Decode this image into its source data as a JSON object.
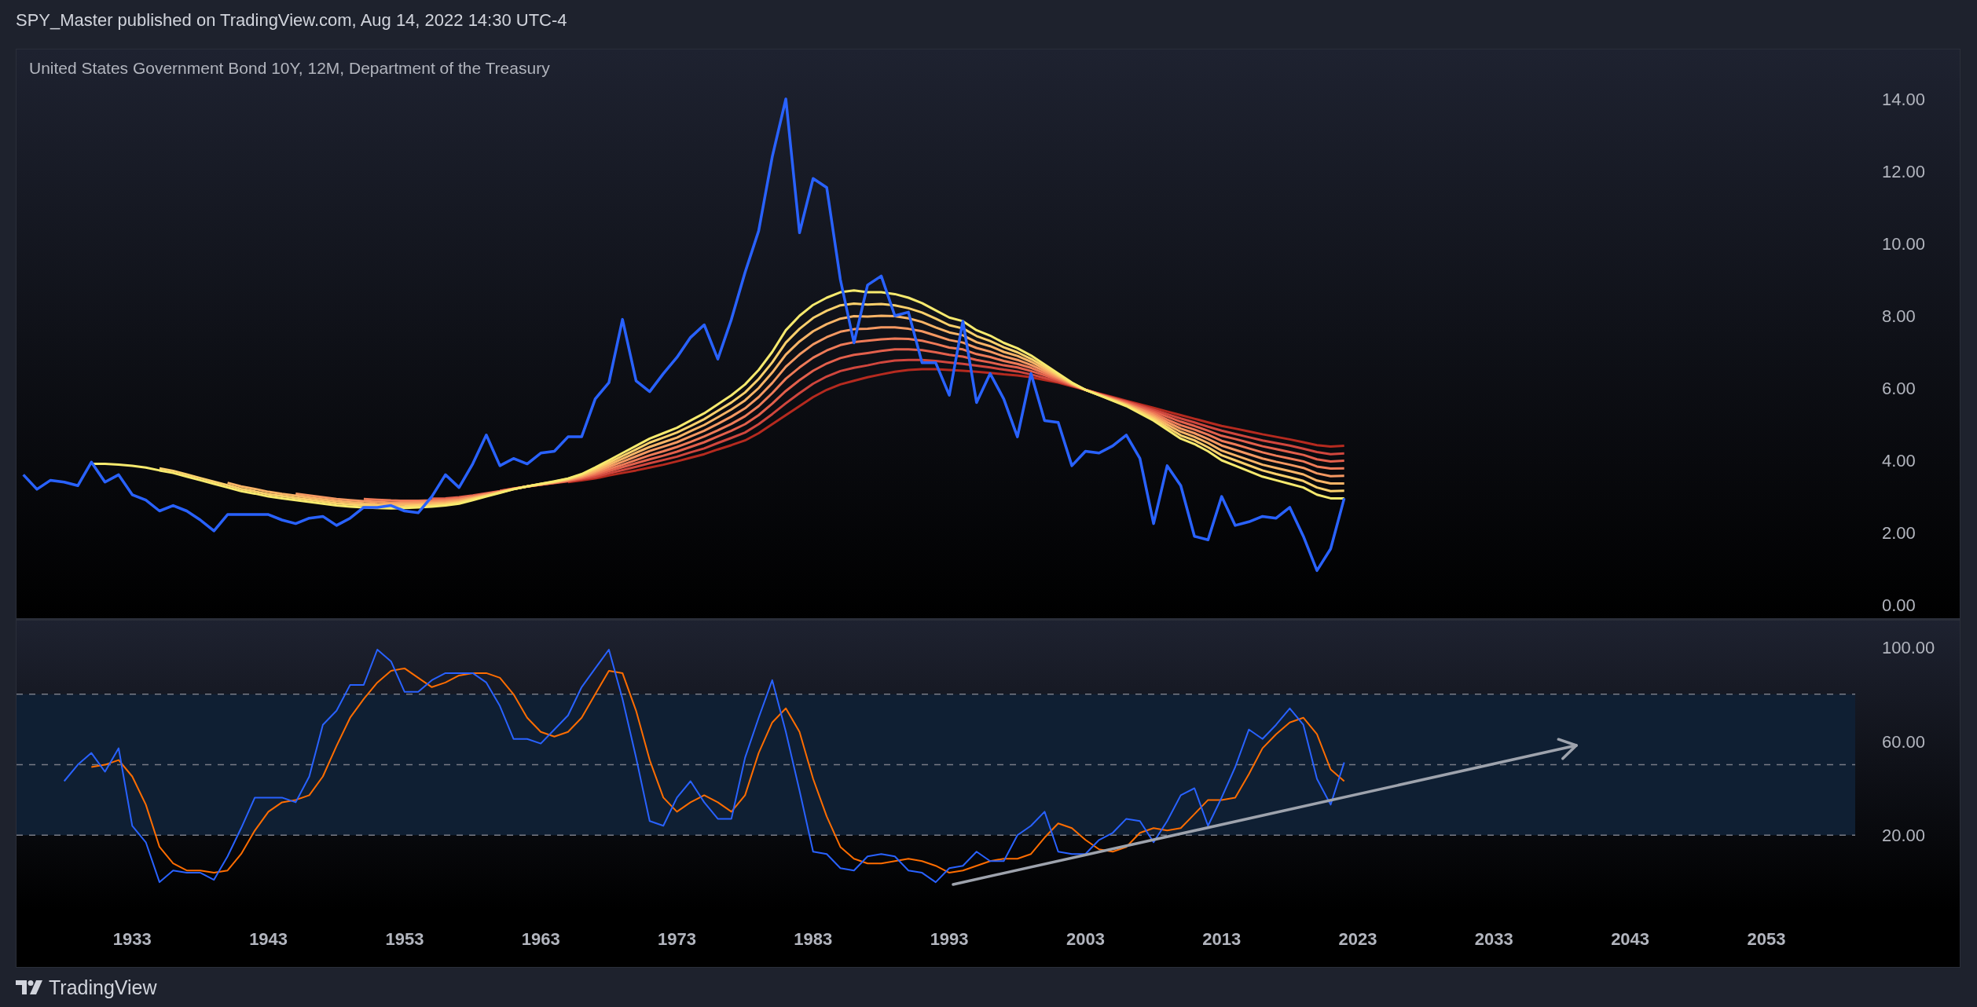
{
  "header": {
    "publish_line": "SPY_Master published on TradingView.com, Aug 14, 2022 14:30 UTC-4"
  },
  "chart": {
    "title": "United States Government Bond 10Y, 12M, Department of the Treasury",
    "price_pane": {
      "chart_data": {
        "type": "line",
        "x": [
          1925,
          1926,
          1927,
          1928,
          1929,
          1930,
          1931,
          1932,
          1933,
          1934,
          1935,
          1936,
          1937,
          1938,
          1939,
          1940,
          1941,
          1942,
          1943,
          1944,
          1945,
          1946,
          1947,
          1948,
          1949,
          1950,
          1951,
          1952,
          1953,
          1954,
          1955,
          1956,
          1957,
          1958,
          1959,
          1960,
          1961,
          1962,
          1963,
          1964,
          1965,
          1966,
          1967,
          1968,
          1969,
          1970,
          1971,
          1972,
          1973,
          1974,
          1975,
          1976,
          1977,
          1978,
          1979,
          1980,
          1981,
          1982,
          1983,
          1984,
          1985,
          1986,
          1987,
          1988,
          1989,
          1990,
          1991,
          1992,
          1993,
          1994,
          1995,
          1996,
          1997,
          1998,
          1999,
          2000,
          2001,
          2002,
          2003,
          2004,
          2005,
          2006,
          2007,
          2008,
          2009,
          2010,
          2011,
          2012,
          2013,
          2014,
          2015,
          2016,
          2017,
          2018,
          2019,
          2020,
          2021,
          2022
        ],
        "series": [
          {
            "color": "#2962ff",
            "values": [
              3.6,
              3.2,
              3.45,
              3.4,
              3.3,
              3.95,
              3.4,
              3.6,
              3.05,
              2.9,
              2.6,
              2.75,
              2.6,
              2.35,
              2.05,
              2.5,
              2.5,
              2.5,
              2.5,
              2.35,
              2.25,
              2.4,
              2.45,
              2.2,
              2.4,
              2.7,
              2.7,
              2.75,
              2.6,
              2.55,
              3.0,
              3.6,
              3.25,
              3.9,
              4.7,
              3.85,
              4.05,
              3.9,
              4.2,
              4.25,
              4.65,
              4.65,
              5.7,
              6.15,
              7.9,
              6.2,
              5.9,
              6.4,
              6.85,
              7.4,
              7.75,
              6.8,
              7.9,
              9.2,
              10.35,
              12.4,
              14.0,
              10.3,
              11.8,
              11.55,
              9.0,
              7.25,
              8.85,
              9.1,
              8.0,
              8.1,
              6.7,
              6.7,
              5.8,
              7.85,
              5.6,
              6.4,
              5.7,
              4.65,
              6.4,
              5.1,
              5.05,
              3.85,
              4.25,
              4.2,
              4.4,
              4.7,
              4.05,
              2.25,
              3.85,
              3.3,
              1.9,
              1.8,
              3.0,
              2.2,
              2.3,
              2.45,
              2.4,
              2.7,
              1.9,
              0.95,
              1.55,
              2.95
            ]
          },
          {
            "color": "#f7ea6e",
            "values": [
              null,
              null,
              null,
              null,
              null,
              3.9,
              3.9,
              3.88,
              3.85,
              3.8,
              3.72,
              3.65,
              3.55,
              3.45,
              3.35,
              3.25,
              3.15,
              3.08,
              3.0,
              2.95,
              2.9,
              2.85,
              2.8,
              2.75,
              2.72,
              2.7,
              2.68,
              2.67,
              2.68,
              2.7,
              2.72,
              2.75,
              2.8,
              2.9,
              3.0,
              3.1,
              3.2,
              3.28,
              3.35,
              3.42,
              3.5,
              3.62,
              3.8,
              4.0,
              4.2,
              4.4,
              4.6,
              4.75,
              4.9,
              5.1,
              5.3,
              5.55,
              5.8,
              6.1,
              6.5,
              7.0,
              7.6,
              8.0,
              8.3,
              8.5,
              8.65,
              8.7,
              8.65,
              8.65,
              8.6,
              8.5,
              8.35,
              8.15,
              7.95,
              7.85,
              7.6,
              7.45,
              7.25,
              7.1,
              6.9,
              6.65,
              6.4,
              6.15,
              5.95,
              5.8,
              5.65,
              5.5,
              5.3,
              5.1,
              4.85,
              4.6,
              4.45,
              4.25,
              4.0,
              3.85,
              3.7,
              3.55,
              3.45,
              3.35,
              3.25,
              3.05,
              2.95,
              2.95
            ]
          },
          {
            "color": "#fbd06c",
            "values": [
              null,
              null,
              null,
              null,
              null,
              null,
              null,
              null,
              null,
              null,
              3.78,
              3.71,
              3.61,
              3.51,
              3.41,
              3.31,
              3.21,
              3.14,
              3.06,
              3.01,
              2.96,
              2.91,
              2.86,
              2.81,
              2.78,
              2.76,
              2.74,
              2.72,
              2.73,
              2.75,
              2.76,
              2.79,
              2.84,
              2.93,
              3.02,
              3.11,
              3.2,
              3.28,
              3.35,
              3.41,
              3.49,
              3.6,
              3.76,
              3.94,
              4.12,
              4.3,
              4.49,
              4.63,
              4.77,
              4.95,
              5.14,
              5.37,
              5.6,
              5.88,
              6.25,
              6.71,
              7.26,
              7.64,
              7.94,
              8.14,
              8.29,
              8.34,
              8.31,
              8.33,
              8.29,
              8.21,
              8.09,
              7.92,
              7.74,
              7.65,
              7.44,
              7.3,
              7.13,
              6.99,
              6.81,
              6.59,
              6.36,
              6.14,
              5.95,
              5.81,
              5.66,
              5.52,
              5.34,
              5.15,
              4.92,
              4.69,
              4.55,
              4.36,
              4.14,
              4.0,
              3.86,
              3.72,
              3.62,
              3.53,
              3.43,
              3.25,
              3.15,
              3.16
            ]
          },
          {
            "color": "#f9b467",
            "values": [
              null,
              null,
              null,
              null,
              null,
              null,
              null,
              null,
              null,
              null,
              null,
              null,
              null,
              null,
              null,
              3.38,
              3.28,
              3.21,
              3.13,
              3.07,
              3.02,
              2.97,
              2.92,
              2.87,
              2.84,
              2.81,
              2.79,
              2.78,
              2.78,
              2.79,
              2.81,
              2.83,
              2.87,
              2.95,
              3.03,
              3.12,
              3.21,
              3.28,
              3.34,
              3.4,
              3.47,
              3.57,
              3.71,
              3.88,
              4.04,
              4.21,
              4.37,
              4.5,
              4.63,
              4.81,
              4.98,
              5.19,
              5.41,
              5.66,
              6.0,
              6.43,
              6.93,
              7.29,
              7.57,
              7.77,
              7.92,
              7.99,
              7.98,
              8.0,
              7.99,
              7.93,
              7.83,
              7.68,
              7.54,
              7.46,
              7.27,
              7.16,
              7.0,
              6.89,
              6.73,
              6.53,
              6.33,
              6.12,
              5.95,
              5.81,
              5.68,
              5.54,
              5.37,
              5.2,
              4.99,
              4.79,
              4.65,
              4.48,
              4.27,
              4.14,
              4.01,
              3.88,
              3.79,
              3.7,
              3.61,
              3.44,
              3.36,
              3.36
            ]
          },
          {
            "color": "#f59862",
            "values": [
              null,
              null,
              null,
              null,
              null,
              null,
              null,
              null,
              null,
              null,
              null,
              null,
              null,
              null,
              null,
              null,
              null,
              null,
              null,
              null,
              3.08,
              3.03,
              2.98,
              2.93,
              2.9,
              2.87,
              2.85,
              2.83,
              2.83,
              2.84,
              2.85,
              2.87,
              2.91,
              2.98,
              3.05,
              3.13,
              3.21,
              3.28,
              3.34,
              3.39,
              3.46,
              3.55,
              3.67,
              3.82,
              3.96,
              4.11,
              4.26,
              4.38,
              4.5,
              4.66,
              4.82,
              5.01,
              5.21,
              5.44,
              5.75,
              6.14,
              6.59,
              6.93,
              7.21,
              7.41,
              7.56,
              7.63,
              7.64,
              7.68,
              7.68,
              7.64,
              7.57,
              7.45,
              7.33,
              7.26,
              7.11,
              7.01,
              6.88,
              6.78,
              6.64,
              6.47,
              6.29,
              6.11,
              5.95,
              5.82,
              5.69,
              5.56,
              5.41,
              5.25,
              5.06,
              4.88,
              4.75,
              4.59,
              4.41,
              4.29,
              4.17,
              4.05,
              3.96,
              3.88,
              3.79,
              3.64,
              3.56,
              3.57
            ]
          },
          {
            "color": "#ef7b58",
            "values": [
              null,
              null,
              null,
              null,
              null,
              null,
              null,
              null,
              null,
              null,
              null,
              null,
              null,
              null,
              null,
              null,
              null,
              null,
              null,
              null,
              null,
              null,
              null,
              null,
              null,
              2.93,
              2.91,
              2.89,
              2.88,
              2.88,
              2.89,
              2.91,
              2.94,
              3.0,
              3.07,
              3.14,
              3.21,
              3.28,
              3.33,
              3.38,
              3.44,
              3.52,
              3.63,
              3.76,
              3.88,
              4.01,
              4.14,
              4.25,
              4.37,
              4.51,
              4.66,
              4.83,
              5.01,
              5.22,
              5.5,
              5.86,
              6.26,
              6.57,
              6.84,
              7.04,
              7.19,
              7.27,
              7.31,
              7.35,
              7.37,
              7.36,
              7.31,
              7.22,
              7.12,
              7.07,
              6.94,
              6.86,
              6.75,
              6.67,
              6.56,
              6.41,
              6.26,
              6.09,
              5.95,
              5.83,
              5.71,
              5.58,
              5.44,
              5.3,
              5.13,
              4.97,
              4.85,
              4.71,
              4.54,
              4.44,
              4.33,
              4.22,
              4.13,
              4.05,
              3.97,
              3.83,
              3.77,
              3.78
            ]
          },
          {
            "color": "#e3604c",
            "values": [
              null,
              null,
              null,
              null,
              null,
              null,
              null,
              null,
              null,
              null,
              null,
              null,
              null,
              null,
              null,
              null,
              null,
              null,
              null,
              null,
              null,
              null,
              null,
              null,
              null,
              null,
              null,
              null,
              null,
              null,
              2.94,
              2.95,
              2.98,
              3.03,
              3.09,
              3.15,
              3.22,
              3.28,
              3.33,
              3.38,
              3.43,
              3.5,
              3.59,
              3.7,
              3.81,
              3.92,
              4.03,
              4.13,
              4.24,
              4.37,
              4.5,
              4.66,
              4.82,
              5.0,
              5.25,
              5.57,
              5.92,
              6.22,
              6.48,
              6.68,
              6.83,
              6.92,
              6.97,
              7.03,
              7.07,
              7.07,
              7.05,
              6.99,
              6.92,
              6.87,
              6.78,
              6.71,
              6.63,
              6.57,
              6.47,
              6.35,
              6.22,
              6.08,
              5.95,
              5.84,
              5.72,
              5.61,
              5.48,
              5.35,
              5.21,
              5.07,
              4.95,
              4.82,
              4.68,
              4.59,
              4.49,
              4.39,
              4.31,
              4.23,
              4.15,
              4.03,
              3.97,
              3.99
            ]
          },
          {
            "color": "#d0463d",
            "values": [
              null,
              null,
              null,
              null,
              null,
              null,
              null,
              null,
              null,
              null,
              null,
              null,
              null,
              null,
              null,
              null,
              null,
              null,
              null,
              null,
              null,
              null,
              null,
              null,
              null,
              null,
              null,
              null,
              null,
              null,
              null,
              null,
              null,
              null,
              null,
              3.16,
              3.22,
              3.27,
              3.33,
              3.37,
              3.42,
              3.48,
              3.54,
              3.64,
              3.73,
              3.82,
              3.92,
              4.01,
              4.1,
              4.22,
              4.33,
              4.48,
              4.62,
              4.77,
              5.0,
              5.28,
              5.58,
              5.86,
              6.12,
              6.32,
              6.47,
              6.56,
              6.63,
              6.71,
              6.76,
              6.78,
              6.78,
              6.75,
              6.71,
              6.67,
              6.62,
              6.57,
              6.51,
              6.46,
              6.38,
              6.28,
              6.18,
              6.07,
              5.95,
              5.84,
              5.73,
              5.63,
              5.52,
              5.4,
              5.28,
              5.16,
              5.05,
              4.93,
              4.82,
              4.73,
              4.64,
              4.55,
              4.48,
              4.41,
              4.32,
              4.23,
              4.17,
              4.19
            ]
          },
          {
            "color": "#b52a1f",
            "values": [
              null,
              null,
              null,
              null,
              null,
              null,
              null,
              null,
              null,
              null,
              null,
              null,
              null,
              null,
              null,
              null,
              null,
              null,
              null,
              null,
              null,
              null,
              null,
              null,
              null,
              null,
              null,
              null,
              null,
              null,
              null,
              null,
              null,
              null,
              null,
              null,
              null,
              null,
              null,
              null,
              3.4,
              3.45,
              3.5,
              3.58,
              3.65,
              3.72,
              3.8,
              3.88,
              3.97,
              4.07,
              4.17,
              4.3,
              4.42,
              4.55,
              4.75,
              5.0,
              5.25,
              5.5,
              5.75,
              5.95,
              6.1,
              6.2,
              6.3,
              6.38,
              6.45,
              6.5,
              6.52,
              6.52,
              6.5,
              6.48,
              6.45,
              6.42,
              6.38,
              6.35,
              6.3,
              6.22,
              6.15,
              6.05,
              5.95,
              5.85,
              5.75,
              5.65,
              5.55,
              5.45,
              5.35,
              5.25,
              5.15,
              5.05,
              4.95,
              4.88,
              4.8,
              4.72,
              4.65,
              4.58,
              4.5,
              4.42,
              4.38,
              4.4
            ]
          }
        ],
        "xlim": [
          1924.5,
          2067.2
        ],
        "ylim": [
          -0.39,
          15.37
        ],
        "yticks": [
          {
            "value": 0,
            "label": "0.00"
          },
          {
            "value": 2,
            "label": "2.00"
          },
          {
            "value": 4,
            "label": "4.00"
          },
          {
            "value": 6,
            "label": "6.00"
          },
          {
            "value": 8,
            "label": "8.00"
          },
          {
            "value": 10,
            "label": "10.00"
          },
          {
            "value": 12,
            "label": "12.00"
          },
          {
            "value": 14,
            "label": "14.00"
          }
        ]
      }
    },
    "oscillator_pane": {
      "chart_data": {
        "type": "line",
        "x": [
          1928,
          1929,
          1930,
          1931,
          1932,
          1933,
          1934,
          1935,
          1936,
          1937,
          1938,
          1939,
          1940,
          1941,
          1942,
          1943,
          1944,
          1945,
          1946,
          1947,
          1948,
          1949,
          1950,
          1951,
          1952,
          1953,
          1954,
          1955,
          1956,
          1957,
          1958,
          1959,
          1960,
          1961,
          1962,
          1963,
          1964,
          1965,
          1966,
          1967,
          1968,
          1969,
          1970,
          1971,
          1972,
          1973,
          1974,
          1975,
          1976,
          1977,
          1978,
          1979,
          1980,
          1981,
          1982,
          1983,
          1984,
          1985,
          1986,
          1987,
          1988,
          1989,
          1990,
          1991,
          1992,
          1993,
          1994,
          1995,
          1996,
          1997,
          1998,
          1999,
          2000,
          2001,
          2002,
          2003,
          2004,
          2005,
          2006,
          2007,
          2008,
          2009,
          2010,
          2011,
          2012,
          2013,
          2014,
          2015,
          2016,
          2017,
          2018,
          2019,
          2020,
          2021,
          2022
        ],
        "series": [
          {
            "color": "#2962ff",
            "values": [
              43,
              50,
              55,
              47,
              57,
              24,
              17,
              0,
              5,
              4,
              4,
              1,
              11,
              23,
              36,
              36,
              36,
              34,
              45,
              67,
              73,
              84,
              84,
              99,
              94,
              81,
              81,
              86,
              89,
              89,
              89,
              85,
              75,
              61,
              61,
              59,
              65,
              71,
              83,
              91,
              99,
              78,
              53,
              26,
              24,
              36,
              43,
              34,
              27,
              27,
              53,
              70,
              86,
              64,
              39,
              13,
              12,
              6,
              5,
              11,
              12,
              11,
              5,
              4,
              0,
              6,
              7,
              13,
              9,
              9,
              20,
              24,
              30,
              13,
              12,
              12,
              18,
              21,
              27,
              26,
              17,
              26,
              37,
              40,
              24,
              36,
              49,
              65,
              61,
              67,
              74,
              67,
              44,
              33,
              51
            ]
          },
          {
            "color": "#ff6d00",
            "values": [
              null,
              null,
              49,
              50,
              52,
              45,
              33,
              15,
              8,
              5,
              5,
              4,
              5,
              12,
              22,
              30,
              34,
              35,
              37,
              45,
              58,
              70,
              78,
              85,
              90,
              91,
              87,
              83,
              85,
              88,
              89,
              89,
              87,
              80,
              70,
              64,
              62,
              64,
              70,
              80,
              90,
              89,
              73,
              52,
              36,
              30,
              34,
              37,
              34,
              30,
              37,
              55,
              68,
              74,
              64,
              44,
              28,
              15,
              10,
              8,
              8,
              9,
              10,
              9,
              7,
              4,
              5,
              7,
              9,
              10,
              10,
              12,
              19,
              25,
              23,
              18,
              14,
              13,
              15,
              21,
              23,
              22,
              23,
              29,
              35,
              35,
              36,
              46,
              57,
              63,
              68,
              70,
              63,
              48,
              43
            ]
          }
        ],
        "xlim": [
          1924.5,
          2067.2
        ],
        "ylim": [
          -35.4,
          111.7
        ],
        "xticks": [
          1933,
          1943,
          1953,
          1963,
          1973,
          1983,
          1993,
          2003,
          2013,
          2023,
          2033,
          2043,
          2053
        ],
        "yticks": [
          {
            "value": 20,
            "label": "20.00"
          },
          {
            "value": 60,
            "label": "60.00"
          },
          {
            "value": 100,
            "label": "100.00"
          }
        ]
      }
    }
  },
  "footer": {
    "brand": "TradingView"
  }
}
